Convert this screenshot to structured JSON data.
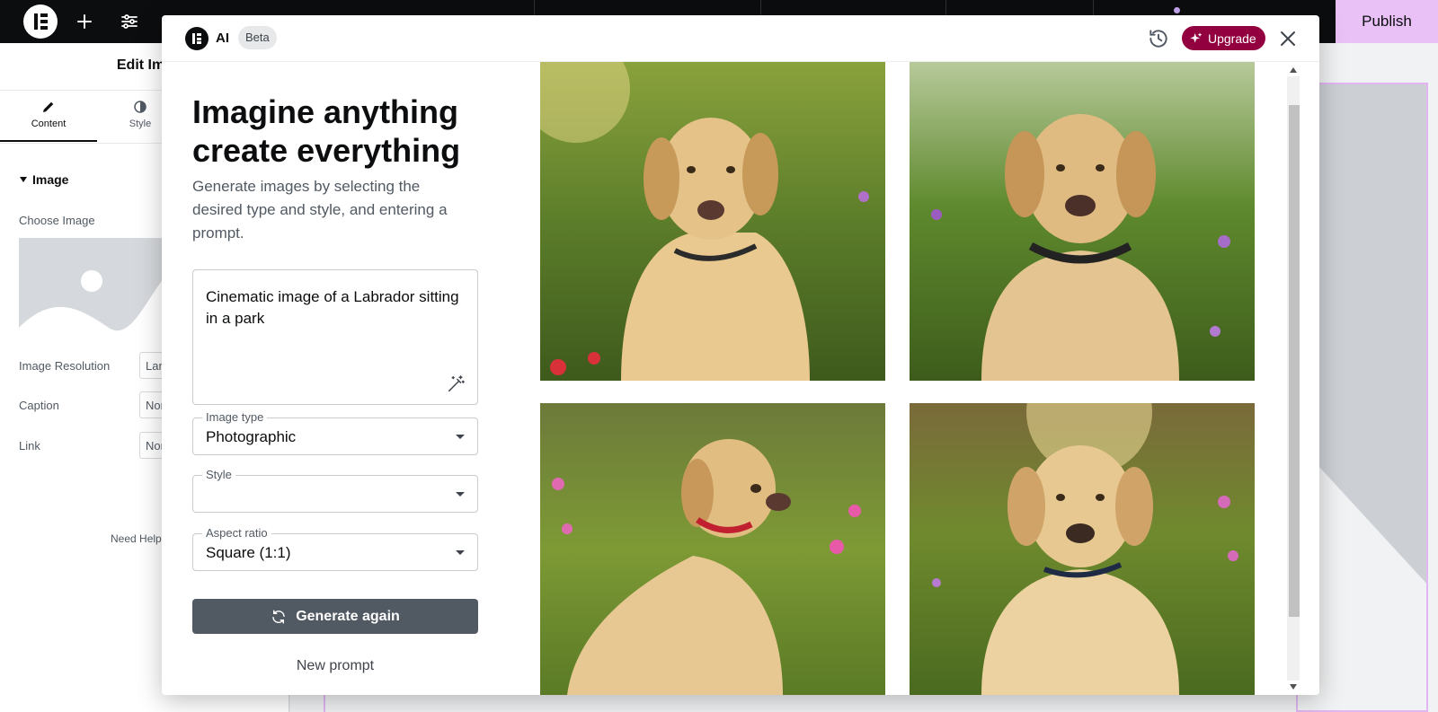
{
  "topbar": {
    "icons": [
      "elementor-logo-icon",
      "plus-icon",
      "sliders-icon"
    ],
    "publish_label": "Publish",
    "accent_color": "#e9c1f7"
  },
  "panel": {
    "title": "Edit Ima",
    "tabs": [
      {
        "label": "Content",
        "icon": "pencil-icon",
        "active": true
      },
      {
        "label": "Style",
        "icon": "half-circle-icon",
        "active": false
      }
    ],
    "section_title": "Image",
    "choose_image_label": "Choose Image",
    "fields": [
      {
        "label": "Image Resolution",
        "value": "Lar"
      },
      {
        "label": "Caption",
        "value": "Nor"
      },
      {
        "label": "Link",
        "value": "Nor"
      }
    ],
    "need_help": "Need Help"
  },
  "modal": {
    "ai_label": "AI",
    "beta_label": "Beta",
    "upgrade_label": "Upgrade",
    "upgrade_color": "#93003f",
    "headline": "Imagine anything create everything",
    "subline": "Generate images by selecting the desired type and style, and entering a prompt.",
    "prompt_text": "Cinematic image of a Labrador sitting in a park",
    "image_type": {
      "label": "Image type",
      "value": "Photographic"
    },
    "style": {
      "label": "Style",
      "value": ""
    },
    "aspect_ratio": {
      "label": "Aspect ratio",
      "value": "Square (1:1)"
    },
    "generate_label": "Generate again",
    "new_prompt_label": "New prompt",
    "images": [
      {
        "subject": "labrador-lying-in-grass"
      },
      {
        "subject": "labrador-sitting-among-flowers"
      },
      {
        "subject": "labrador-sitting-red-collar"
      },
      {
        "subject": "labrador-lying-sunset"
      }
    ]
  }
}
